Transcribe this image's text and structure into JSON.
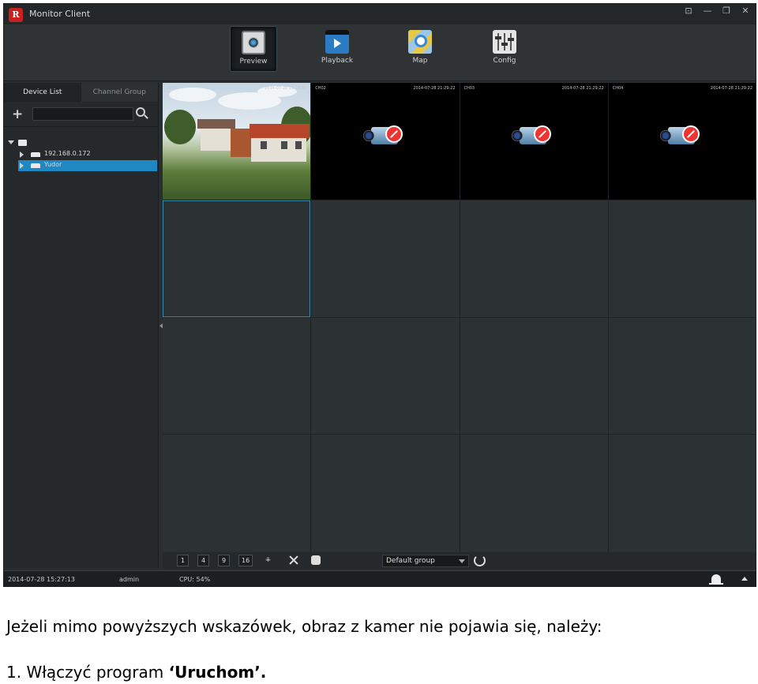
{
  "window": {
    "title": "Monitor Client",
    "logo_text": "R",
    "controls": [
      "⊡",
      "—",
      "❐",
      "✕"
    ]
  },
  "toolbar": {
    "items": [
      {
        "label": "Preview",
        "icon": "preview-camera-icon"
      },
      {
        "label": "Playback",
        "icon": "playback-clapper-icon"
      },
      {
        "label": "Map",
        "icon": "map-icon"
      },
      {
        "label": "Config",
        "icon": "config-sliders-icon"
      }
    ],
    "active": "Preview"
  },
  "left_panel": {
    "tabs": [
      "Device List",
      "Channel Group"
    ],
    "active_tab": "Device List",
    "search_value": "",
    "tree": {
      "nodes": [
        "192.168.0.172",
        "Yudor"
      ],
      "selected": "Yudor"
    }
  },
  "video_grid": {
    "layout": "4x4",
    "cells": [
      {
        "channel": "CH01",
        "timestamp": "2014-07-28 21:29:22",
        "state": "live"
      },
      {
        "channel": "CH02",
        "timestamp": "2014-07-28 21:29:22",
        "state": "offline"
      },
      {
        "channel": "CH03",
        "timestamp": "2014-07-28 21:29:22",
        "state": "offline"
      },
      {
        "channel": "CH04",
        "timestamp": "2014-07-28 21:29:22",
        "state": "offline"
      }
    ]
  },
  "bottombar": {
    "layout_buttons": [
      "1",
      "4",
      "9",
      "16"
    ],
    "custom_layout_icon": "custom-layout-icon",
    "group_select": "Default group"
  },
  "status": {
    "datetime": "2014-07-28 15:27:13",
    "user": "admin",
    "cpu": "CPU: 54%"
  },
  "document": {
    "line1": "Jeżeli mimo powyższych wskazówek, obraz z kamer nie pojawia się, należy:",
    "line2_prefix": "1. Włączyć program ",
    "line2_bold": "‘Uruchom’."
  },
  "colors": {
    "accent": "#1f88c2",
    "logo": "#c8201e",
    "background": "#2a2e31"
  }
}
